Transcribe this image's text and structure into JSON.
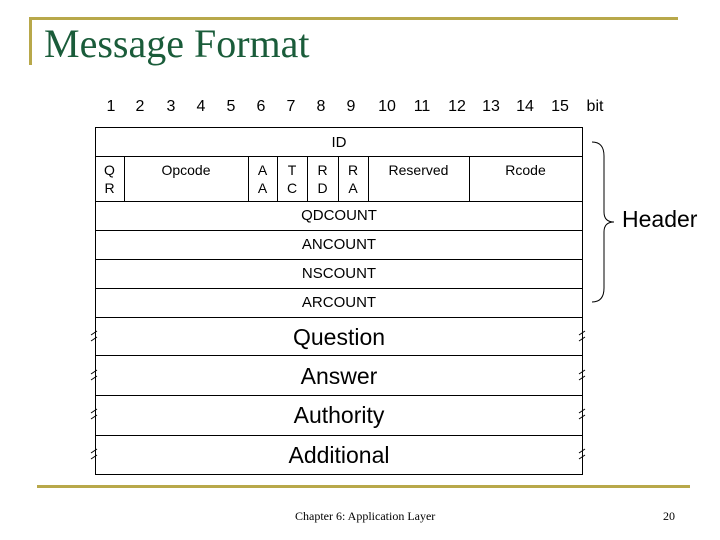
{
  "slide": {
    "title": "Message Format",
    "accent_color": "#b8a84a",
    "title_color": "#1a5c3a"
  },
  "bit_ruler": {
    "numbers": [
      "1",
      "2",
      "3",
      "4",
      "5",
      "6",
      "7",
      "8",
      "9",
      "10",
      "11",
      "12",
      "13",
      "14",
      "15"
    ],
    "unit_label": "bit"
  },
  "header_fields": {
    "id": "ID",
    "flags": [
      {
        "name": "qr",
        "line1": "Q",
        "line2": "R"
      },
      {
        "name": "opcode",
        "line1": "Opcode",
        "line2": ""
      },
      {
        "name": "aa",
        "line1": "A",
        "line2": "A"
      },
      {
        "name": "tc",
        "line1": "T",
        "line2": "C"
      },
      {
        "name": "rd",
        "line1": "R",
        "line2": "D"
      },
      {
        "name": "ra",
        "line1": "R",
        "line2": "A"
      },
      {
        "name": "reserved",
        "line1": "Reserved",
        "line2": ""
      },
      {
        "name": "rcode",
        "line1": "Rcode",
        "line2": ""
      }
    ],
    "counts": [
      "QDCOUNT",
      "ANCOUNT",
      "NSCOUNT",
      "ARCOUNT"
    ]
  },
  "sections": [
    "Question",
    "Answer",
    "Authority",
    "Additional"
  ],
  "brace_label": "Header",
  "footer": {
    "chapter": "Chapter 6: Application Layer",
    "page_number": "20"
  }
}
